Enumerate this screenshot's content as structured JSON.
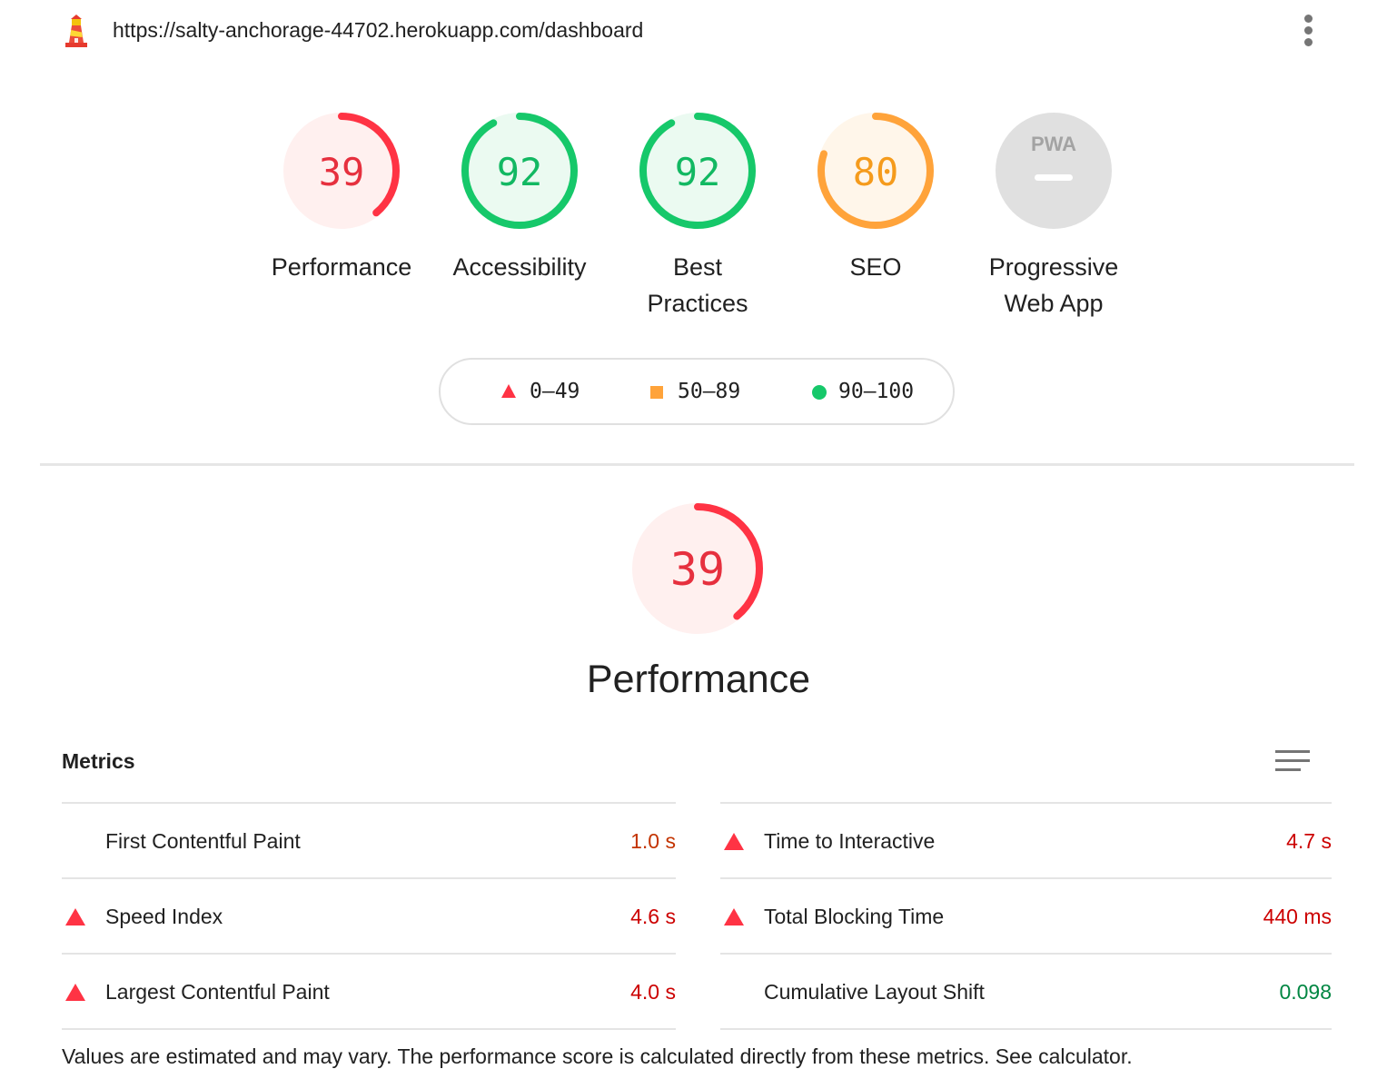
{
  "header": {
    "url": "https://salty-anchorage-44702.herokuapp.com/dashboard",
    "logo_icon": "lighthouse-logo-icon",
    "menu_icon": "more-vertical-icon"
  },
  "colors": {
    "fail": "#ff3333",
    "fail_bg": "#fff0ef",
    "pass": "#0cce6b",
    "pass_bg": "#ebfaf1",
    "average": "#ffa400",
    "average_bg": "#fff6ea",
    "na": "#e0e0e0",
    "na_text": "#9e9e9e",
    "value_fail": "#cc0000",
    "value_average": "#c33300",
    "value_pass": "#018642"
  },
  "categories": [
    {
      "score": 39,
      "label": "Performance",
      "status": "fail"
    },
    {
      "score": 92,
      "label": "Accessibility",
      "status": "pass"
    },
    {
      "score": 92,
      "label": "Best Practices",
      "status": "pass"
    },
    {
      "score": 80,
      "label": "SEO",
      "status": "average"
    },
    {
      "badge": "PWA",
      "label": "Progressive Web App",
      "status": "na"
    }
  ],
  "legend": {
    "fail": "0–49",
    "average": "50–89",
    "pass": "90–100"
  },
  "performance": {
    "score": 39,
    "title": "Performance"
  },
  "metrics": {
    "title": "Metrics",
    "toggle_icon": "metrics-view-toggle-icon",
    "left": [
      {
        "name": "First Contentful Paint",
        "value": "1.0 s",
        "status": "average"
      },
      {
        "name": "Speed Index",
        "value": "4.6 s",
        "status": "fail"
      },
      {
        "name": "Largest Contentful Paint",
        "value": "4.0 s",
        "status": "fail"
      }
    ],
    "right": [
      {
        "name": "Time to Interactive",
        "value": "4.7 s",
        "status": "fail"
      },
      {
        "name": "Total Blocking Time",
        "value": "440 ms",
        "status": "fail"
      },
      {
        "name": "Cumulative Layout Shift",
        "value": "0.098",
        "status": "pass"
      }
    ]
  },
  "footer_note": "Values are estimated and may vary. The performance score is calculated directly from these metrics. See calculator."
}
